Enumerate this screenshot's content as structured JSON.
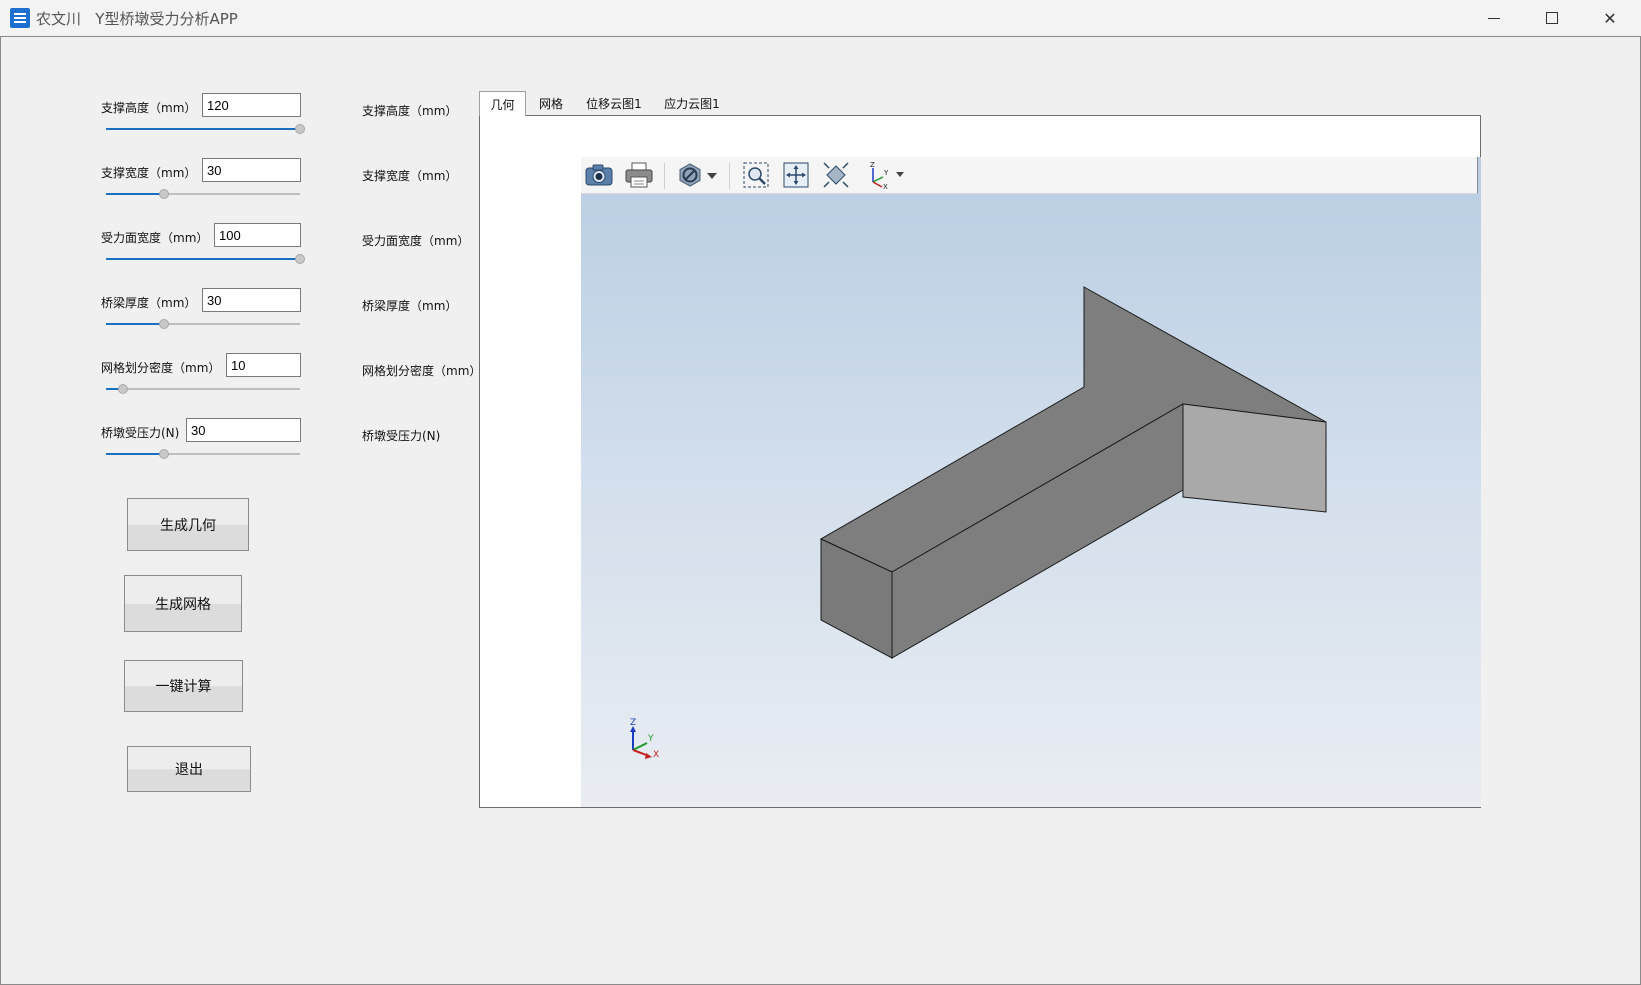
{
  "window": {
    "title": "农文川   Y型桥墩受力分析APP",
    "minimize_symbol": "",
    "close_symbol": "✕"
  },
  "params": [
    {
      "label": "支撑高度（mm）",
      "value": "120",
      "slider_fraction": 1.0
    },
    {
      "label": "支撑宽度（mm）",
      "value": "30",
      "slider_fraction": 0.3
    },
    {
      "label": "受力面宽度（mm）",
      "value": "100",
      "slider_fraction": 1.0
    },
    {
      "label": "桥梁厚度（mm）",
      "value": "30",
      "slider_fraction": 0.3
    },
    {
      "label": "网格划分密度（mm）",
      "value": "10",
      "slider_fraction": 0.09
    },
    {
      "label": "桥墩受压力(N)",
      "value": "30",
      "slider_fraction": 0.3
    }
  ],
  "buttons": {
    "generate_geometry": "生成几何",
    "generate_mesh": "生成网格",
    "compute": "一键计算",
    "exit": "退出"
  },
  "mid_labels": [
    "支撑高度（mm）",
    "支撑宽度（mm）",
    "受力面宽度（mm）",
    "桥梁厚度（mm）",
    "网格划分密度（mm）",
    "桥墩受压力(N)"
  ],
  "tabs": [
    "几何",
    "网格",
    "位移云图1",
    "应力云图1"
  ],
  "active_tab": "几何",
  "axes": {
    "x": "X",
    "y": "Y",
    "z": "Z"
  },
  "colors": {
    "slider_fill": "#1a6fbf",
    "viewer_top": "#b9cde3",
    "viewer_bottom": "#e9edf2"
  },
  "icons": [
    "camera-icon",
    "printer-icon",
    "display-mode-icon",
    "dropdown-arrow-icon",
    "zoom-box-icon",
    "pan-icon",
    "fit-view-icon",
    "axes-orientation-icon"
  ]
}
